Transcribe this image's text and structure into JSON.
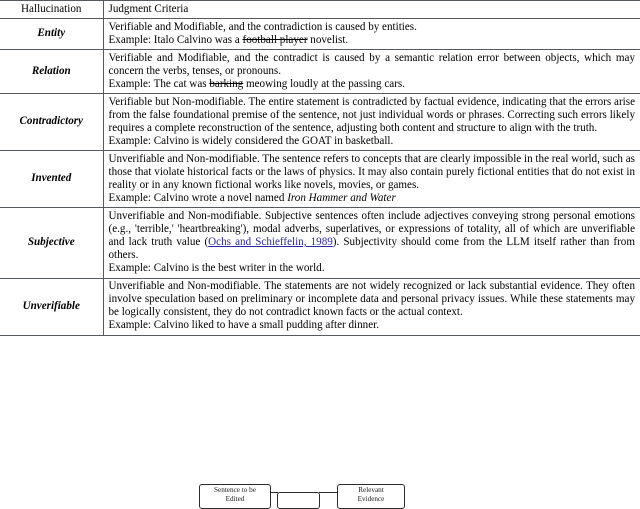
{
  "table": {
    "header": {
      "type_label": "Hallucination",
      "criteria_label": "Judgment Criteria"
    },
    "rows": [
      {
        "type": "Entity",
        "description": "Verifiable and Modifiable, and the contradiction is caused by entities.",
        "example_prefix": "Example: Italo Calvino was a ",
        "example_strike": "football player",
        "example_suffix": " novelist."
      },
      {
        "type": "Relation",
        "description": "Verifiable and Modifiable, and the contradict is caused by a semantic relation error between objects, which may concern the verbs, tenses, or pronouns.",
        "example_prefix": "Example: The cat was ",
        "example_strike": "barking",
        "example_suffix": " meowing loudly at the passing cars."
      },
      {
        "type": "Contradictory",
        "description": "Verifiable but Non-modifiable. The entire statement is contradicted by factual evidence, indicating that the errors arise from the false foundational premise of the sentence, not just individual words or phrases. Correcting such errors likely requires a complete reconstruction of the sentence, adjusting both content and structure to align with the truth.",
        "example_prefix": "Example: Calvino is widely considered the GOAT in basketball.",
        "example_strike": "",
        "example_suffix": ""
      },
      {
        "type": "Invented",
        "description": "Unverifiable and Non-modifiable. The sentence refers to concepts that are clearly impossible in the real world, such as those that violate historical facts or the laws of physics. It may also contain purely fictional entities that do not exist in reality or in any known fictional works like novels, movies, or games.",
        "example_prefix": "Example: Calvino wrote a novel named ",
        "example_italic": "Iron Hammer and Water",
        "example_strike": "",
        "example_suffix": ""
      },
      {
        "type": "Subjective",
        "description_part1": "Unverifiable and Non-modifiable. Subjective sentences often include adjectives conveying strong personal emotions (e.g., 'terrible,' 'heartbreaking'), modal adverbs, superlatives, or expressions of totality, all of which are unverifiable and lack truth value (",
        "description_citation": "Ochs and Schieffelin, 1989",
        "description_part2": "). Subjectivity should come from the LLM itself rather than from others.",
        "example_prefix": "Example: Calvino is the best writer in the world.",
        "example_strike": "",
        "example_suffix": ""
      },
      {
        "type": "Unverifiable",
        "description": "Unverifiable and Non-modifiable. The statements are not widely recognized or lack substantial evidence. They often involve speculation based on preliminary or incomplete data and personal privacy issues. While these statements may be logically consistent, they do not contradict known facts or the actual context.",
        "example_prefix": "Example: Calvino liked to have a small pudding after dinner.",
        "example_strike": "",
        "example_suffix": ""
      }
    ]
  },
  "diagram": {
    "box_sentence_line1": "Sentence to be",
    "box_sentence_line2": "Edited",
    "box_evidence_line1": "Relevant",
    "box_evidence_line2": "Evidence"
  },
  "colors": {
    "rule": "#555a5f",
    "citation_link": "#2a2aa0",
    "text": "#000000"
  }
}
